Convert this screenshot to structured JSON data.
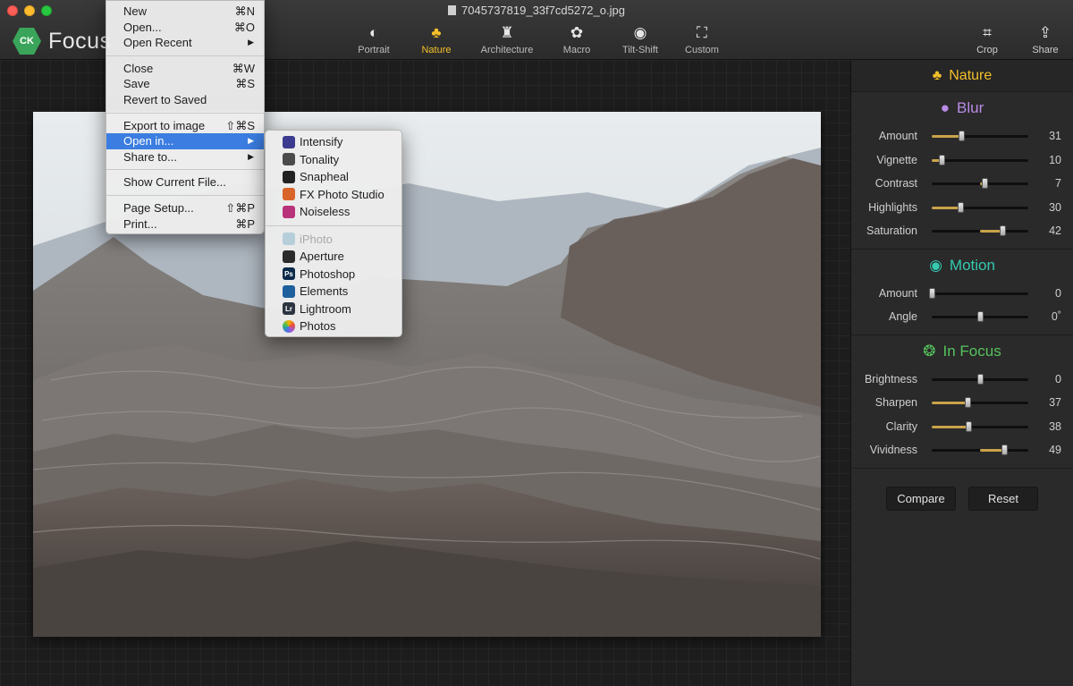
{
  "window": {
    "title": "7045737819_33f7cd5272_o.jpg"
  },
  "app": {
    "name": "Focus",
    "badge": "CK"
  },
  "toolbar": {
    "modes": [
      {
        "label": "Portrait",
        "icon": "portrait-icon",
        "active": false
      },
      {
        "label": "Nature",
        "icon": "tree-icon",
        "active": true
      },
      {
        "label": "Architecture",
        "icon": "statue-icon",
        "active": false
      },
      {
        "label": "Macro",
        "icon": "flower-icon",
        "active": false
      },
      {
        "label": "Tilt-Shift",
        "icon": "tiltshift-icon",
        "active": false
      },
      {
        "label": "Custom",
        "icon": "custom-icon",
        "active": false
      }
    ],
    "crop_label": "Crop",
    "share_label": "Share"
  },
  "file_menu": {
    "items": [
      {
        "label": "New",
        "shortcut": "⌘N"
      },
      {
        "label": "Open...",
        "shortcut": "⌘O"
      },
      {
        "label": "Open Recent",
        "submenu": true
      },
      {
        "sep": true
      },
      {
        "label": "Close",
        "shortcut": "⌘W"
      },
      {
        "label": "Save",
        "shortcut": "⌘S"
      },
      {
        "label": "Revert to Saved",
        "shortcut": ""
      },
      {
        "sep": true
      },
      {
        "label": "Export to image",
        "shortcut": "⇧⌘S"
      },
      {
        "label": "Open in...",
        "submenu": true,
        "highlighted": true
      },
      {
        "label": "Share to...",
        "submenu": true
      },
      {
        "sep": true
      },
      {
        "label": "Show Current File...",
        "shortcut": ""
      },
      {
        "sep": true
      },
      {
        "label": "Page Setup...",
        "shortcut": "⇧⌘P"
      },
      {
        "label": "Print...",
        "shortcut": "⌘P"
      }
    ]
  },
  "open_in_menu": {
    "items": [
      {
        "label": "Intensify",
        "icon": "intensify-icon",
        "color": "#3b3b8f"
      },
      {
        "label": "Tonality",
        "icon": "tonality-icon",
        "color": "#4b4b4b"
      },
      {
        "label": "Snapheal",
        "icon": "snapheal-icon",
        "color": "#222222"
      },
      {
        "label": "FX Photo Studio",
        "icon": "fx-photo-studio-icon",
        "color": "#d9642a"
      },
      {
        "label": "Noiseless",
        "icon": "noiseless-icon",
        "color": "#b8327a"
      },
      {
        "sep": true
      },
      {
        "label": "iPhoto",
        "icon": "iphoto-icon",
        "color": "#7fb2c9",
        "disabled": true
      },
      {
        "label": "Aperture",
        "icon": "aperture-icon",
        "color": "#2b2b2b"
      },
      {
        "label": "Photoshop",
        "icon": "photoshop-icon",
        "color": "#0b2a4a",
        "glyph": "Ps"
      },
      {
        "label": "Elements",
        "icon": "elements-icon",
        "color": "#1e5f9e"
      },
      {
        "label": "Lightroom",
        "icon": "lightroom-icon",
        "color": "#2b3440",
        "glyph": "Lr"
      },
      {
        "label": "Photos",
        "icon": "photos-icon",
        "color": "#f2f2f2"
      }
    ]
  },
  "panel": {
    "title": "Nature",
    "sections": [
      {
        "title": "Blur",
        "color": "#b98ce6",
        "icon": "drop-icon",
        "sliders": [
          {
            "label": "Amount",
            "value": "31",
            "pos": 0.31,
            "fill_from": 0
          },
          {
            "label": "Vignette",
            "value": "10",
            "pos": 0.1,
            "fill_from": 0
          },
          {
            "label": "Contrast",
            "value": "7",
            "pos": 0.55,
            "fill_from": 0.5
          },
          {
            "label": "Highlights",
            "value": "30",
            "pos": 0.3,
            "fill_from": 0
          },
          {
            "label": "Saturation",
            "value": "42",
            "pos": 0.73,
            "fill_from": 0.5
          }
        ]
      },
      {
        "title": "Motion",
        "color": "#35c9b0",
        "icon": "motion-icon",
        "sliders": [
          {
            "label": "Amount",
            "value": "0",
            "pos": 0.0,
            "fill_from": 0
          },
          {
            "label": "Angle",
            "value": "0˚",
            "pos": 0.5,
            "fill_from": 0.5
          }
        ]
      },
      {
        "title": "In Focus",
        "color": "#56c35e",
        "icon": "focus-icon",
        "sliders": [
          {
            "label": "Brightness",
            "value": "0",
            "pos": 0.5,
            "fill_from": 0.5
          },
          {
            "label": "Sharpen",
            "value": "37",
            "pos": 0.37,
            "fill_from": 0
          },
          {
            "label": "Clarity",
            "value": "38",
            "pos": 0.38,
            "fill_from": 0
          },
          {
            "label": "Vividness",
            "value": "49",
            "pos": 0.75,
            "fill_from": 0.5
          }
        ]
      }
    ],
    "compare_label": "Compare",
    "reset_label": "Reset"
  }
}
